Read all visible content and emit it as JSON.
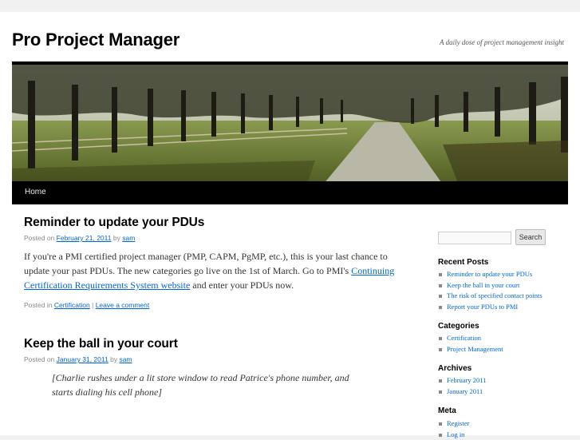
{
  "site": {
    "title": "Pro Project Manager",
    "description": "A daily dose of project management insight"
  },
  "nav": {
    "home": "Home"
  },
  "posts": [
    {
      "title": "Reminder to update your PDUs",
      "posted_on": "Posted on",
      "date": "February 21, 2011",
      "by": "by",
      "author": "sam",
      "body_before_link": "If you're a PMI certified project manager (PMP, CAPM, PgMP, etc.), this is your last chance to update your past PDUs. The new categories go live on the 1st of March. Go to PMI's",
      "link": "Continuing Certification Requirements System website",
      "body_after_link": "and enter your PDUs now.",
      "posted_in": "Posted in",
      "category": "Certification",
      "separator": "|",
      "comment": "Leave a comment"
    },
    {
      "title": "Keep the ball in your court",
      "posted_on": "Posted on",
      "date": "January 31, 2011",
      "by": "by",
      "author": "sam",
      "quote": "[Charlie rushes under a lit store window to read Patrice's phone number, and starts dialing his cell phone]"
    }
  ],
  "sidebar": {
    "search_button": "Search",
    "recent_posts": {
      "title": "Recent Posts",
      "items": [
        "Reminder to update your PDUs",
        "Keep the ball in your court",
        "The risk of specified contact points",
        "Report your PDUs to PMI"
      ]
    },
    "categories": {
      "title": "Categories",
      "items": [
        "Certification",
        "Project Management"
      ]
    },
    "archives": {
      "title": "Archives",
      "items": [
        "February 2011",
        "January 2011"
      ]
    },
    "meta": {
      "title": "Meta",
      "items": [
        "Register",
        "Log in"
      ]
    }
  },
  "colors": {
    "link": "#0066cc",
    "nav_bg": "#000000",
    "page_bg": "#f1f1f1"
  }
}
